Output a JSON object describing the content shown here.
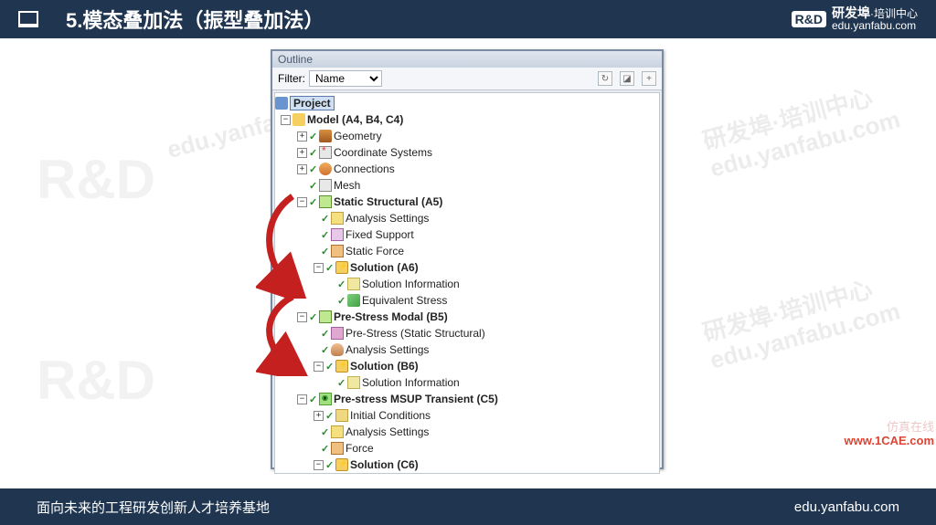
{
  "header": {
    "title": "5.模态叠加法（振型叠加法）",
    "brand": "研发埠",
    "brand_sub": "·培训中心",
    "brand_url": "edu.yanfabu.com",
    "rd": "R&D"
  },
  "outline": {
    "title": "Outline",
    "filter_label": "Filter:",
    "filter_value": "Name"
  },
  "tree": {
    "project": "Project",
    "model": "Model (A4, B4, C4)",
    "geometry": "Geometry",
    "coord": "Coordinate Systems",
    "connections": "Connections",
    "mesh": "Mesh",
    "static": "Static Structural (A5)",
    "analysis_settings": "Analysis Settings",
    "fixed_support": "Fixed Support",
    "static_force": "Static Force",
    "solution_a6": "Solution (A6)",
    "sol_info": "Solution Information",
    "eq_stress": "Equivalent Stress",
    "prestress_modal": "Pre-Stress Modal (B5)",
    "prestress_static": "Pre-Stress (Static Structural)",
    "solution_b6": "Solution (B6)",
    "msup": "Pre-stress MSUP Transient (C5)",
    "init_cond": "Initial Conditions",
    "force": "Force",
    "solution_c6": "Solution (C6)"
  },
  "watermarks": {
    "site": "edu.yanfabu.com",
    "com": ".COM",
    "brand_cn": "研发埠·培训中心"
  },
  "footer": {
    "left": "面向未来的工程研发创新人才培养基地",
    "right": "edu.yanfabu.com"
  },
  "corner": {
    "line1": "仿真在线",
    "line2": "www.1CAE.com"
  }
}
